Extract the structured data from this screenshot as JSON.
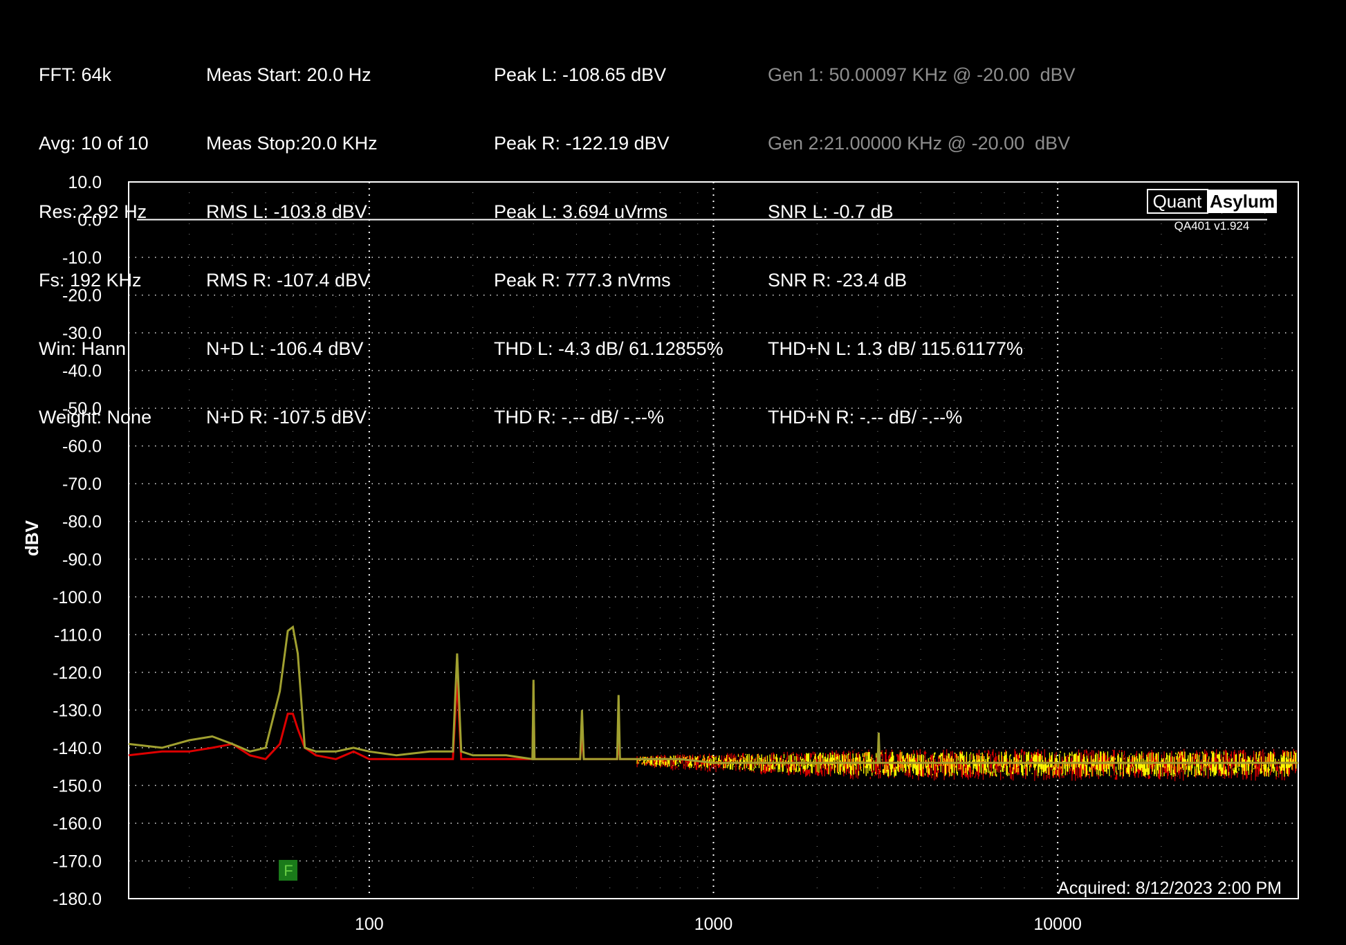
{
  "measurements": {
    "col1": [
      "FFT: 64k",
      "Avg: 10 of 10",
      "Res: 2.92 Hz",
      "Fs: 192 KHz",
      "Win: Hann",
      "Weight: None"
    ],
    "col2": [
      "Meas Start: 20.0 Hz",
      "Meas Stop:20.0 KHz",
      "RMS L: -103.8 dBV",
      "RMS R: -107.4 dBV",
      "N+D L: -106.4 dBV",
      "N+D R: -107.5 dBV"
    ],
    "col3": [
      "Peak L: -108.65 dBV",
      "Peak R: -122.19 dBV",
      "Peak L: 3.694 uVrms",
      "Peak R: 777.3 nVrms",
      "THD L: -4.3 dB/ 61.12855%",
      "THD R: -.-- dB/ -.--%"
    ],
    "col4": [
      "Gen 1: 50.00097 KHz @ -20.00  dBV",
      "Gen 2:21.00000 KHz @ -20.00  dBV",
      "SNR L: -0.7 dB",
      "SNR R: -23.4 dB",
      "THD+N L: 1.3 dB/ 115.61177%",
      "THD+N R: -.-- dB/ -.--%"
    ],
    "col4_dim_rows": 2
  },
  "brand": {
    "part1": "Quant",
    "part2": "Asylum",
    "version": "QA401 v1.924"
  },
  "acquired": "Acquired: 8/12/2023  2:00 PM",
  "marker": "F",
  "colors": {
    "left": "#ffff00",
    "right": "#dd0000",
    "left_low": "#a0a030",
    "grid": "#ffffff",
    "marker": "#1a7a1a"
  },
  "chart_data": {
    "type": "line",
    "ylabel": "dBV",
    "xlabel": "",
    "xscale": "log",
    "xlim": [
      20,
      50000
    ],
    "ylim": [
      -180,
      10
    ],
    "yticks": [
      "10.0",
      "0.0",
      "-10.0",
      "-20.0",
      "-30.0",
      "-40.0",
      "-50.0",
      "-60.0",
      "-70.0",
      "-80.0",
      "-90.0",
      "-100.0",
      "-110.0",
      "-120.0",
      "-130.0",
      "-140.0",
      "-150.0",
      "-160.0",
      "-170.0",
      "-180.0"
    ],
    "xticks": [
      "100",
      "1000",
      "10000"
    ],
    "reference_line_y": 0,
    "series": [
      {
        "channel": "left",
        "x": [
          20,
          25,
          30,
          35,
          40,
          45,
          50,
          55,
          58,
          60,
          62,
          65,
          70,
          80,
          90,
          100,
          120,
          150,
          175,
          180,
          185,
          200,
          250,
          298,
          300,
          302,
          350,
          410,
          415,
          420,
          500,
          525,
          530,
          535,
          600,
          800,
          1000,
          1500,
          2000,
          3000,
          3020,
          3040,
          5000,
          10000,
          20000,
          50000
        ],
        "y": [
          -139,
          -140,
          -138,
          -137,
          -139,
          -141,
          -140,
          -125,
          -109,
          -108,
          -115,
          -140,
          -141,
          -141,
          -140,
          -141,
          -142,
          -141,
          -141,
          -115,
          -141,
          -142,
          -142,
          -143,
          -122,
          -143,
          -143,
          -143,
          -130,
          -143,
          -143,
          -143,
          -126,
          -143,
          -143,
          -143,
          -144,
          -144,
          -144,
          -144,
          -136,
          -144,
          -144,
          -144,
          -144,
          -144
        ]
      },
      {
        "channel": "right",
        "x": [
          20,
          25,
          30,
          35,
          40,
          45,
          50,
          55,
          58,
          60,
          62,
          65,
          70,
          80,
          90,
          100,
          120,
          150,
          175,
          180,
          185,
          200,
          250,
          298,
          300,
          302,
          350,
          410,
          415,
          420,
          500,
          525,
          530,
          535,
          600,
          800,
          1000,
          1500,
          2000,
          3000,
          5000,
          10000,
          20000,
          50000
        ],
        "y": [
          -142,
          -141,
          -141,
          -140,
          -139,
          -142,
          -143,
          -139,
          -131,
          -131,
          -135,
          -140,
          -142,
          -143,
          -141,
          -143,
          -143,
          -143,
          -143,
          -122,
          -143,
          -143,
          -143,
          -143,
          -123,
          -143,
          -143,
          -143,
          -137,
          -143,
          -143,
          -143,
          -138,
          -143,
          -143,
          -143,
          -144,
          -144,
          -144,
          -144,
          -144,
          -144,
          -144,
          -144
        ]
      }
    ],
    "noise_band_db": [
      -148,
      -140
    ]
  }
}
